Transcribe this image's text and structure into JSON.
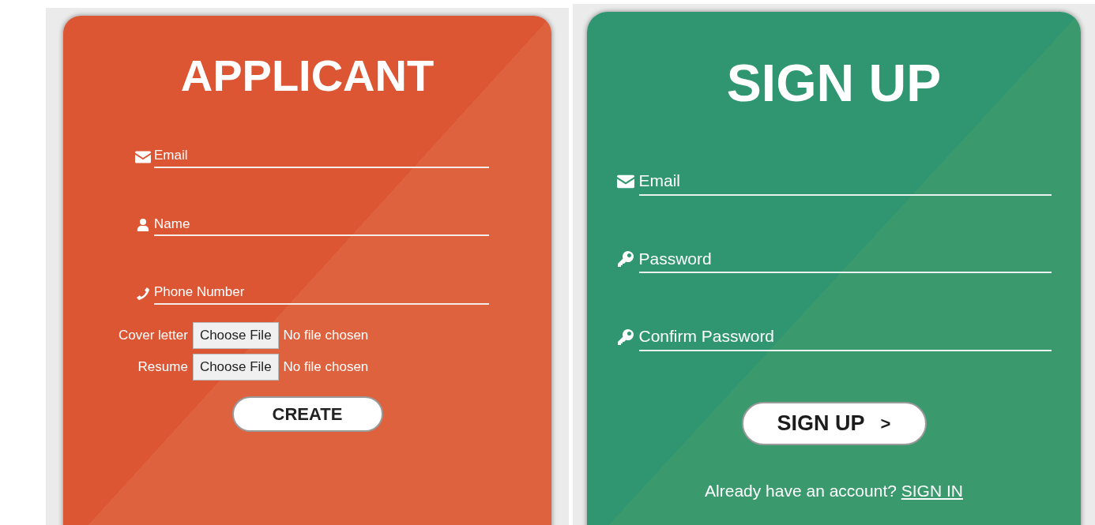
{
  "applicant": {
    "title": "APPLICANT",
    "fields": [
      {
        "kind": "email",
        "placeholder": "Email"
      },
      {
        "kind": "person",
        "placeholder": "Name"
      },
      {
        "kind": "phone",
        "placeholder": "Phone Number"
      }
    ],
    "uploads": [
      {
        "label": "Cover letter",
        "button": "Choose File",
        "status": "No file chosen"
      },
      {
        "label": "Resume",
        "button": "Choose File",
        "status": "No file chosen"
      }
    ],
    "submit": "CREATE"
  },
  "signup": {
    "title": "SIGN UP",
    "fields": [
      {
        "kind": "email",
        "placeholder": "Email"
      },
      {
        "kind": "key",
        "placeholder": "Password"
      },
      {
        "kind": "key",
        "placeholder": "Confirm Password"
      }
    ],
    "submit": {
      "label": "SIGN UP",
      "arrow": ">"
    },
    "footer": {
      "text": "Already have an account?",
      "link": "SIGN IN"
    }
  }
}
